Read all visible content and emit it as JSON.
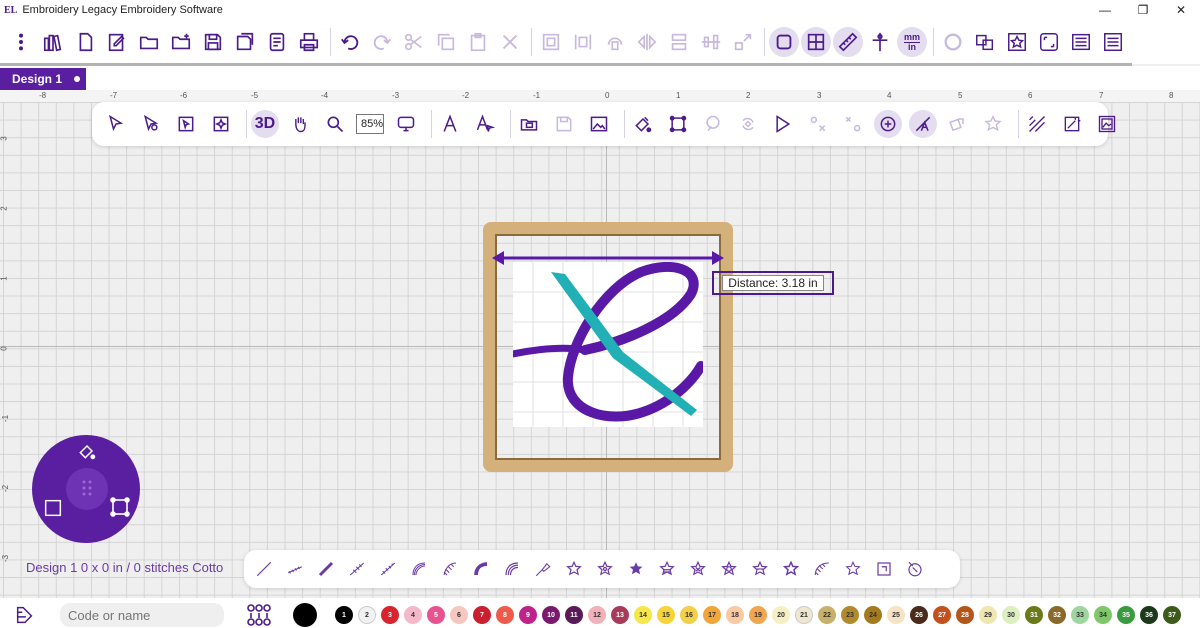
{
  "app": {
    "logo": "EL",
    "title": "Embroidery Legacy Embroidery Software",
    "window_controls": [
      "—",
      "❐",
      "✕"
    ]
  },
  "toolbar": {
    "units_top": "mm",
    "units_bottom": "in"
  },
  "tabs": [
    {
      "label": "Design 1"
    }
  ],
  "rulers": {
    "top": [
      "-8",
      "-7",
      "-6",
      "-5",
      "-4",
      "-3",
      "-2",
      "-1",
      "0",
      "1",
      "2",
      "3",
      "4",
      "5",
      "6",
      "7",
      "8"
    ],
    "left": [
      "3",
      "2",
      "1",
      "0",
      "-1",
      "-2",
      "-3"
    ]
  },
  "float_toolbar": {
    "view_3d_label": "3D",
    "zoom_value": "85%"
  },
  "measure": {
    "tooltip": "Distance: 3.18 in"
  },
  "status": {
    "text": "Design 1 0 x 0 in / 0 stitches Cotto"
  },
  "bottom": {
    "search_placeholder": "Code or name",
    "thread_swatches": [
      {
        "num": "1",
        "color": "#000000",
        "text": "#ffffff"
      },
      {
        "num": "2",
        "color": "#f1f1f1",
        "text": "#333333"
      },
      {
        "num": "3",
        "color": "#d9232e",
        "text": "#ffffff"
      },
      {
        "num": "4",
        "color": "#f4b9c9",
        "text": "#333333"
      },
      {
        "num": "5",
        "color": "#e8528f",
        "text": "#ffffff"
      },
      {
        "num": "6",
        "color": "#f5c7c0",
        "text": "#333333"
      },
      {
        "num": "7",
        "color": "#c8202f",
        "text": "#ffffff"
      },
      {
        "num": "8",
        "color": "#ee5b4a",
        "text": "#ffffff"
      },
      {
        "num": "9",
        "color": "#c0218a",
        "text": "#ffffff"
      },
      {
        "num": "10",
        "color": "#7a1a6e",
        "text": "#ffffff"
      },
      {
        "num": "11",
        "color": "#5a1a57",
        "text": "#ffffff"
      },
      {
        "num": "12",
        "color": "#f2b1b8",
        "text": "#333333"
      },
      {
        "num": "13",
        "color": "#a83a5c",
        "text": "#ffffff"
      },
      {
        "num": "14",
        "color": "#f7e64a",
        "text": "#333333"
      },
      {
        "num": "15",
        "color": "#f7d43a",
        "text": "#333333"
      },
      {
        "num": "16",
        "color": "#f3cf4a",
        "text": "#333333"
      },
      {
        "num": "17",
        "color": "#f2a53a",
        "text": "#333333"
      },
      {
        "num": "18",
        "color": "#f8c9a2",
        "text": "#333333"
      },
      {
        "num": "19",
        "color": "#f0a54e",
        "text": "#333333"
      },
      {
        "num": "20",
        "color": "#f6efc4",
        "text": "#333333"
      },
      {
        "num": "21",
        "color": "#efe8d0",
        "text": "#333333"
      },
      {
        "num": "22",
        "color": "#c9b06a",
        "text": "#333333"
      },
      {
        "num": "23",
        "color": "#b28a2e",
        "text": "#333333"
      },
      {
        "num": "24",
        "color": "#a47a1e",
        "text": "#333333"
      },
      {
        "num": "25",
        "color": "#f6e3c6",
        "text": "#333333"
      },
      {
        "num": "26",
        "color": "#4a2a1a",
        "text": "#ffffff"
      },
      {
        "num": "27",
        "color": "#c2511e",
        "text": "#ffffff"
      },
      {
        "num": "28",
        "color": "#b4561a",
        "text": "#ffffff"
      },
      {
        "num": "29",
        "color": "#efe6b0",
        "text": "#333333"
      },
      {
        "num": "30",
        "color": "#dcefc0",
        "text": "#333333"
      },
      {
        "num": "31",
        "color": "#6a7a1a",
        "text": "#ffffff"
      },
      {
        "num": "32",
        "color": "#8a6a2a",
        "text": "#ffffff"
      },
      {
        "num": "33",
        "color": "#9fd6a0",
        "text": "#333333"
      },
      {
        "num": "34",
        "color": "#7ec86a",
        "text": "#333333"
      },
      {
        "num": "35",
        "color": "#3a9a3e",
        "text": "#ffffff"
      },
      {
        "num": "36",
        "color": "#1a3a1a",
        "text": "#ffffff"
      },
      {
        "num": "37",
        "color": "#3e5a1a",
        "text": "#ffffff"
      }
    ]
  },
  "colors": {
    "accent": "#4b1a8c",
    "tab": "#5a1ea0",
    "hoop": "#d4b07a",
    "design_purple": "#5a18a6",
    "design_teal": "#20b0b5"
  }
}
